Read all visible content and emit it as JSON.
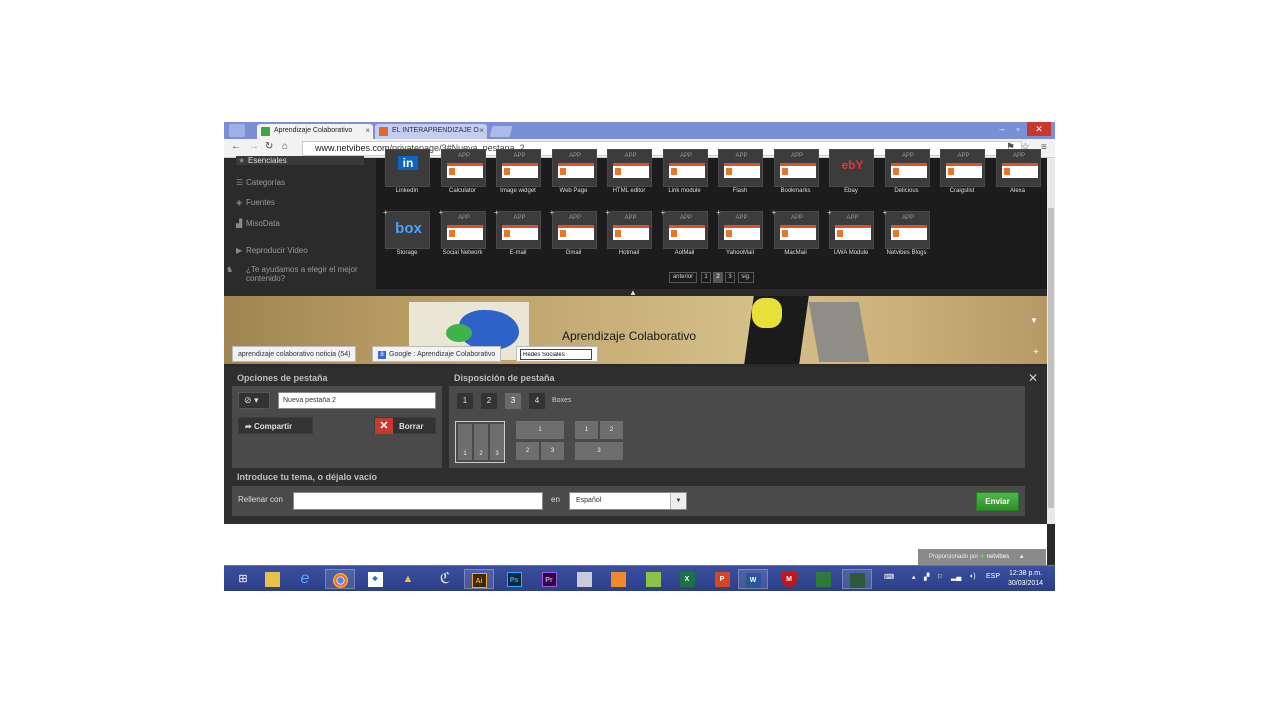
{
  "browser": {
    "tabs": [
      {
        "label": "Aprendizaje Colaborativo",
        "close": "×"
      },
      {
        "label": "EL INTERAPRENDIZAJE O",
        "close": "×"
      }
    ],
    "window_buttons": {
      "minimize": "–",
      "maximize": "▫",
      "close": "✕"
    },
    "url_host": "www.netvibes.com",
    "url_path": "/privatepage/3#Nueva_pestana_2"
  },
  "sidebar": {
    "items": [
      {
        "icon": "★",
        "label": "Esenciales"
      },
      {
        "icon": "☰",
        "label": "Categorías"
      },
      {
        "icon": "◈",
        "label": "Fuentes"
      },
      {
        "icon": "▟",
        "label": "MisoData"
      },
      {
        "icon": "▶",
        "label": "Reproducir Video"
      },
      {
        "icon": "♞",
        "label": "¿Te ayudamos a elegir el mejor contenido?"
      }
    ]
  },
  "apps": {
    "row1": [
      "LinkedIn",
      "Calculator",
      "Image widget",
      "Web Page",
      "HTML editor",
      "Link module",
      "Flash",
      "Bookmarks",
      "Ebay",
      "Delicious",
      "Craigslist",
      "Alexa"
    ],
    "row2": [
      "Storage",
      "Social Network",
      "E-mail",
      "Gmail",
      "Hotmail",
      "AolMail",
      "YahooMail",
      "MacMail",
      "UWA Module",
      "Netvibes Blogs"
    ],
    "tile_tag": "APP",
    "storage_logo": "box",
    "linkedin_logo": "in",
    "ebay_logo": "ebY"
  },
  "pagination": {
    "prev": "anterior",
    "pages": [
      "1",
      "2",
      "3"
    ],
    "current": "2",
    "next": "sig."
  },
  "banner": {
    "title": "Aprendizaje Colaborativo",
    "tabs": [
      {
        "label": "aprendizaje colaborativo noticia (54)"
      },
      {
        "label": "Google : Aprendizaje Colaborativo",
        "icon": "8"
      },
      {
        "label": "Redes Sociales"
      }
    ],
    "add": "+"
  },
  "options": {
    "tab_options_title": "Opciones de pestaña",
    "tab_name_value": "Nueva pestaña 2",
    "icon_select": "⊘ ▾",
    "share_label": "Compartir",
    "delete_label": "Borrar",
    "layout_title": "Disposición de pestaña",
    "column_options": [
      "1",
      "2",
      "3",
      "4"
    ],
    "selected_columns": "3",
    "boxes_label": "Boxes",
    "topic_title": "Introduce tu tema, o déjalo vacío",
    "fill_label": "Rellenar con",
    "fill_value": "",
    "in_label": "en",
    "language": "Español",
    "send_label": "Enviar",
    "close": "✕"
  },
  "footer": {
    "powered_by": "Proporcionado por",
    "brand": "netvibes",
    "caret": "▲"
  },
  "taskbar": {
    "tray_lang": "ESP",
    "time": "12:38 p.m.",
    "date": "30/03/2014",
    "app_labels": {
      "illustrator": "Ai",
      "photoshop": "Ps",
      "premiere": "Pr",
      "excel": "X",
      "powerpoint": "P",
      "word": "W",
      "mcafee": "M"
    }
  }
}
